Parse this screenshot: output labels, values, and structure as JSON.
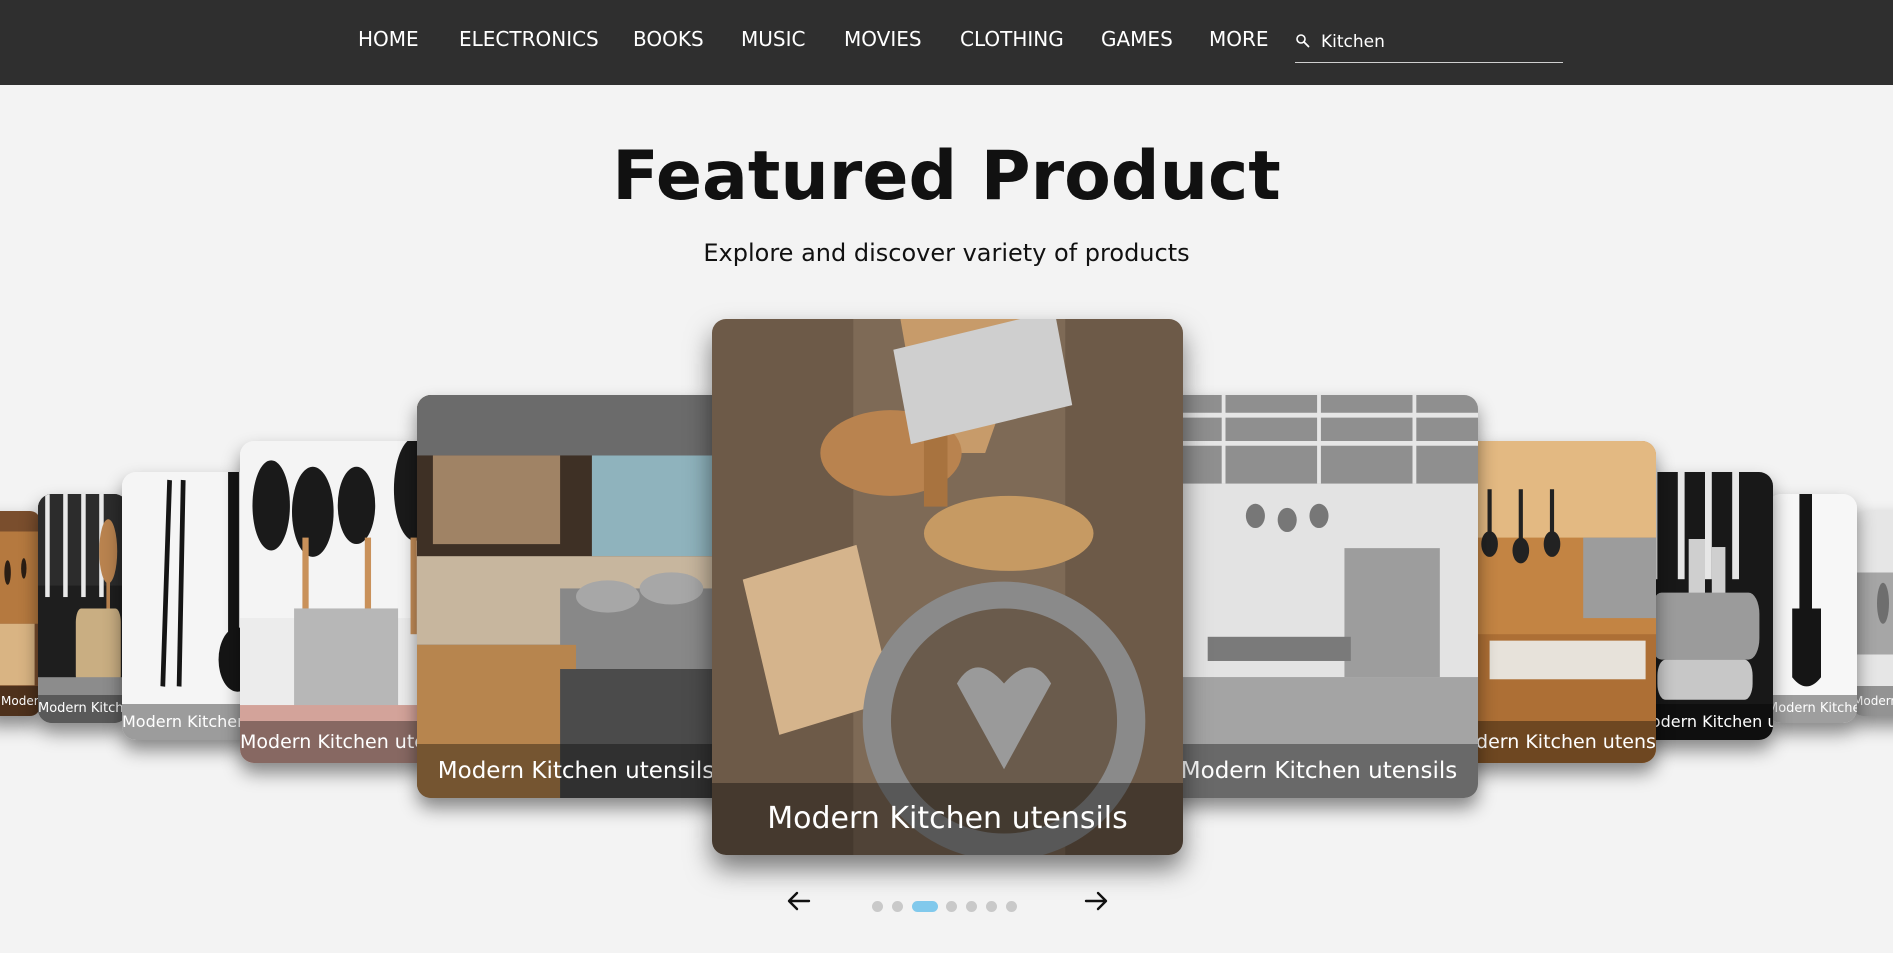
{
  "nav": {
    "items": [
      "HOME",
      "ELECTRONICS",
      "BOOKS",
      "MUSIC",
      "MOVIES",
      "CLOTHING",
      "GAMES",
      "MORE"
    ],
    "search": {
      "value": "Kitchen",
      "icon": "search-icon"
    }
  },
  "hero": {
    "title": "Featured Product",
    "subtitle": "Explore and discover variety of products"
  },
  "carousel": {
    "slides": [
      {
        "caption": "Modern Kitchen utensils",
        "image": "warm restaurant kitchen"
      },
      {
        "caption": "Modern Kitchen utensils",
        "image": "utensils in woven basket"
      },
      {
        "caption": "Modern Kitchen utensils",
        "image": "black tongs and ladle"
      },
      {
        "caption": "Modern Kitchen utensils",
        "image": "black utensils in steel holder"
      },
      {
        "caption": "Modern Kitchen utensils",
        "image": "busy kitchen with stove and pans"
      },
      {
        "caption": "Modern Kitchen utensils",
        "image": "wooden spoons, grater and cookie cutter"
      },
      {
        "caption": "Modern Kitchen utensils",
        "image": "industrial steel kitchen"
      },
      {
        "caption": "Modern Kitchen utensils",
        "image": "warm kitchen with hanging pots"
      },
      {
        "caption": "Modern Kitchen utensils",
        "image": "stacked steel pots with utensils"
      },
      {
        "caption": "Modern Kitchen utensils",
        "image": "black slotted spatula"
      },
      {
        "caption": "Modern Kitchen utensils",
        "image": "kitchen edge"
      }
    ],
    "prev_icon": "arrow-left-icon",
    "next_icon": "arrow-right-icon",
    "dot_count": 7,
    "active_dot": 2
  },
  "colors": {
    "navbar": "#2f2f2f",
    "page_background": "#f3f3f3",
    "active_dot": "#81c9ec",
    "inactive_dot": "#c9c9c9"
  }
}
